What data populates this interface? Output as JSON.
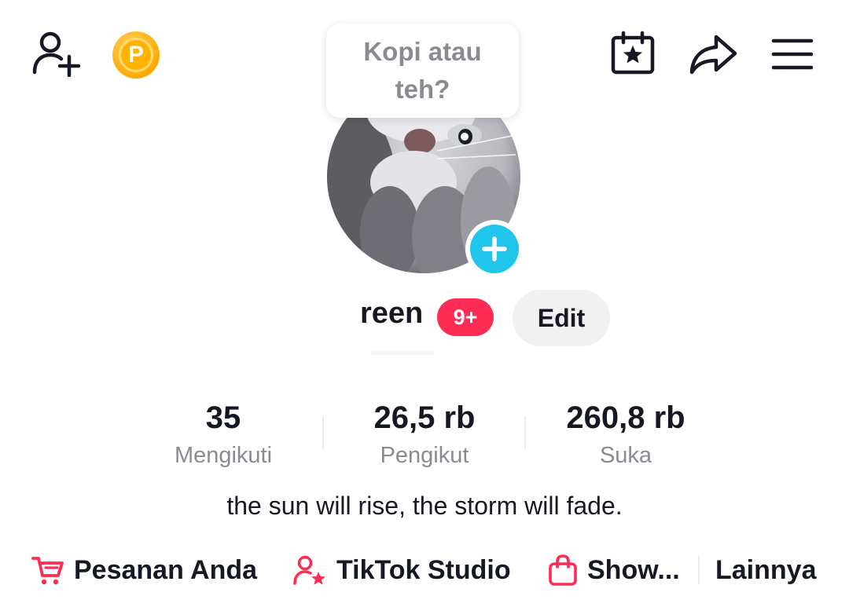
{
  "header": {
    "add_friend_icon": "person-add-icon",
    "coin_letter": "P",
    "calendar_icon": "calendar-star-icon",
    "share_icon": "share-arrow-icon",
    "menu_icon": "hamburger-menu-icon"
  },
  "note_bubble": {
    "text": "Kopi atau teh?"
  },
  "profile": {
    "username": "reen",
    "notification_badge": "9+",
    "edit_label": "Edit",
    "bio": "the sun will rise, the storm will fade."
  },
  "stats": [
    {
      "value": "35",
      "label": "Mengikuti"
    },
    {
      "value": "26,5 rb",
      "label": "Pengikut"
    },
    {
      "value": "260,8 rb",
      "label": "Suka"
    }
  ],
  "links": {
    "orders": "Pesanan Anda",
    "studio": "TikTok Studio",
    "shop": "Show...",
    "more": "Lainnya"
  },
  "colors": {
    "accent_red": "#fe2c55",
    "plus_blue": "#20c5ec",
    "coin_orange": "#ffaa00",
    "muted_text": "#8a8b91"
  }
}
